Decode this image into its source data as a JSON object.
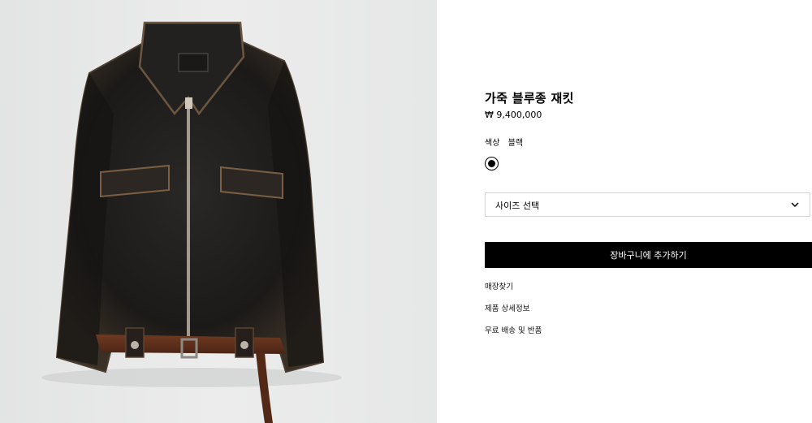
{
  "product": {
    "name": "가죽 블루종 재킷",
    "price": "₩ 9,400,000",
    "color_label": "색상",
    "color_value": "블랙",
    "color_swatch": "#000000"
  },
  "size_select": {
    "placeholder": "사이즈 선택",
    "icon": "chevron-down-icon"
  },
  "cart": {
    "label": "장바구니에 추가하기"
  },
  "links": [
    "매장찾기",
    "제품 상세정보",
    "무료 배송 및 반품"
  ],
  "image": {
    "subject": "distressed black leather jacket with brown belt"
  }
}
